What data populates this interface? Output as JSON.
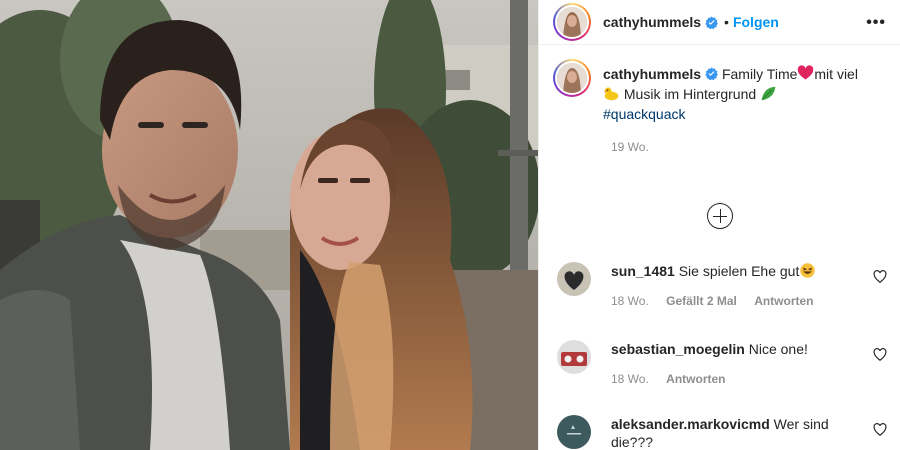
{
  "post": {
    "author": "cathyhummels",
    "follow_label": "Folgen",
    "dot": "•",
    "more_label": "•••",
    "caption": {
      "text_1": "Family Time",
      "text_2": "mit viel",
      "text_3": "Musik im Hintergrund",
      "hashtag": "#quackquack"
    },
    "age": "19 Wo."
  },
  "comments": [
    {
      "user": "sun_1481",
      "text": "Sie spielen Ehe gut",
      "age": "18 Wo.",
      "likes": "Gefällt 2 Mal",
      "reply": "Antworten"
    },
    {
      "user": "sebastian_moegelin",
      "text": "Nice one!",
      "age": "18 Wo.",
      "reply": "Antworten"
    },
    {
      "user": "aleksander.markovicmd",
      "text": "Wer sind die???"
    }
  ],
  "colors": {
    "follow": "#0095f6",
    "hashtag": "#00376b",
    "meta": "#8e8e8e",
    "verified": "#3897f0"
  },
  "icons": [
    "verified-badge-icon",
    "more-options-icon",
    "load-more-comments-icon",
    "heart-icon",
    "heart-emoji-icon",
    "duck-emoji-icon",
    "leaf-emoji-icon",
    "laughing-emoji-icon"
  ]
}
